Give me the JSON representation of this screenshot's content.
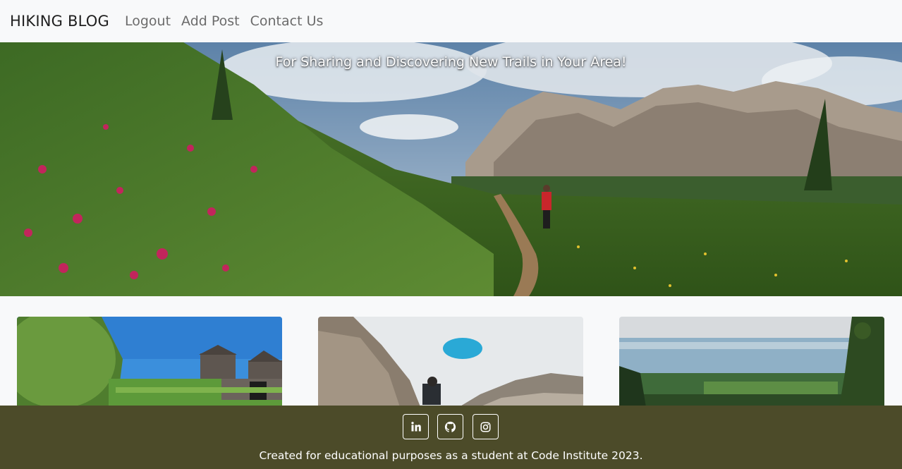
{
  "navbar": {
    "brand": "HIKING BLOG",
    "links": [
      {
        "label": "Logout"
      },
      {
        "label": "Add Post"
      },
      {
        "label": "Contact Us"
      }
    ]
  },
  "hero": {
    "tagline": "For Sharing and Discovering New Trails in Your Area!"
  },
  "cards": [
    {
      "image": "castle-ruins-photo"
    },
    {
      "image": "mountain-hiker-photo"
    },
    {
      "image": "lake-valley-photo"
    }
  ],
  "footer": {
    "social": [
      {
        "icon": "linkedin-icon"
      },
      {
        "icon": "github-icon"
      },
      {
        "icon": "instagram-icon"
      }
    ],
    "text": "Created for educational purposes as a student at Code Institute 2023.",
    "background": "#4c4b29"
  }
}
